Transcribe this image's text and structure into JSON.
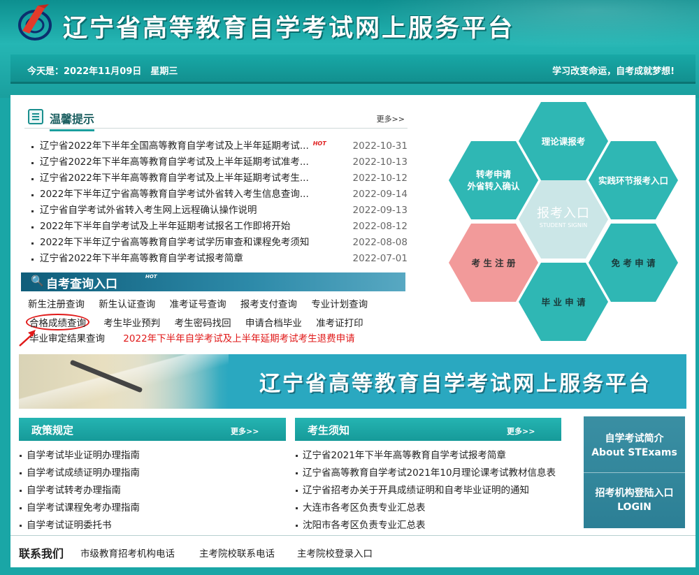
{
  "header": {
    "site_title": "辽宁省高等教育自学考试网上服务平台",
    "today": "今天是：2022年11月09日　星期三",
    "motto": "学习改变命运，自考成就梦想!"
  },
  "notice": {
    "title": "温馨提示",
    "more": "更多>>",
    "items": [
      {
        "title": "辽宁省2022年下半年全国高等教育自学考试及上半年延期考试...",
        "hot": "HOT",
        "date": "2022-10-31"
      },
      {
        "title": "辽宁省2022年下半年高等教育自学考试及上半年延期考试准考...",
        "hot": "",
        "date": "2022-10-13"
      },
      {
        "title": "辽宁省2022年下半年高等教育自学考试及上半年延期考试考生...",
        "hot": "",
        "date": "2022-10-12"
      },
      {
        "title": "2022年下半年辽宁省高等教育自学考试外省转入考生信息查询...",
        "hot": "",
        "date": "2022-09-14"
      },
      {
        "title": "辽宁省自学考试外省转入考生网上远程确认操作说明",
        "hot": "",
        "date": "2022-09-13"
      },
      {
        "title": "2022年下半年自学考试及上半年延期考试报名工作即将开始",
        "hot": "",
        "date": "2022-08-12"
      },
      {
        "title": "2022年下半年辽宁省高等教育自学考试学历审查和课程免考须知",
        "hot": "",
        "date": "2022-08-08"
      },
      {
        "title": "辽宁省2022年下半年高等教育自学考试报考简章",
        "hot": "",
        "date": "2022-07-01"
      }
    ]
  },
  "query": {
    "title": "自考查询入口",
    "hot": "HOT",
    "row1": [
      "新生注册查询",
      "新生认证查询",
      "准考证号查询",
      "报考支付查询",
      "专业计划查询"
    ],
    "row2": [
      "合格成绩查询",
      "考生毕业预判",
      "考生密码找回",
      "申请合档毕业",
      "准考证打印"
    ],
    "row3": [
      "毕业审定结果查询"
    ],
    "row3_red": "2022年下半年自学考试及上半年延期考试考生退费申请"
  },
  "hexes": {
    "top": "理论课报考",
    "left_l1": "转考申请",
    "left_l2": "外省转入确认",
    "right_top": "实践环节报考入口",
    "center_big": "报考入口",
    "center_small": "STUDENT SIGNIN",
    "pink": "考 生 注 册",
    "right_bottom": "免 考 申 请",
    "bottom": "毕 业 申 请"
  },
  "banner": {
    "title": "辽宁省高等教育自学考试网上服务平台"
  },
  "policy": {
    "title": "政策规定",
    "more": "更多>>",
    "items": [
      "自学考试毕业证明办理指南",
      "自学考试成绩证明办理指南",
      "自学考试转考办理指南",
      "自学考试课程免考办理指南",
      "自学考试证明委托书"
    ]
  },
  "exam": {
    "title": "考生须知",
    "more": "更多>>",
    "items": [
      "辽宁省2021年下半年高等教育自学考试报考简章",
      "辽宁省高等教育自学考试2021年10月理论课考试教材信息表",
      "辽宁省招考办关于开具成绩证明和自考毕业证明的通知",
      "大连市各考区负责专业汇总表",
      "沈阳市各考区负责专业汇总表"
    ]
  },
  "side": {
    "b1_l1": "自学考试简介",
    "b1_l2": "About STExams",
    "b2_l1": "招考机构登陆入口",
    "b2_l2": "LOGIN"
  },
  "contact": {
    "label": "联系我们",
    "links": [
      "市级教育招考机构电话",
      "主考院校联系电话",
      "主考院校登录入口"
    ]
  },
  "colors": {
    "teal": "#1aa6a6",
    "hex_teal": "#2fb7b4",
    "hex_pink": "#f29a9a",
    "highlight_red": "#e01818"
  },
  "icons": [
    "logo-icon",
    "notice-icon",
    "search-icon",
    "red-arrow-icon"
  ]
}
